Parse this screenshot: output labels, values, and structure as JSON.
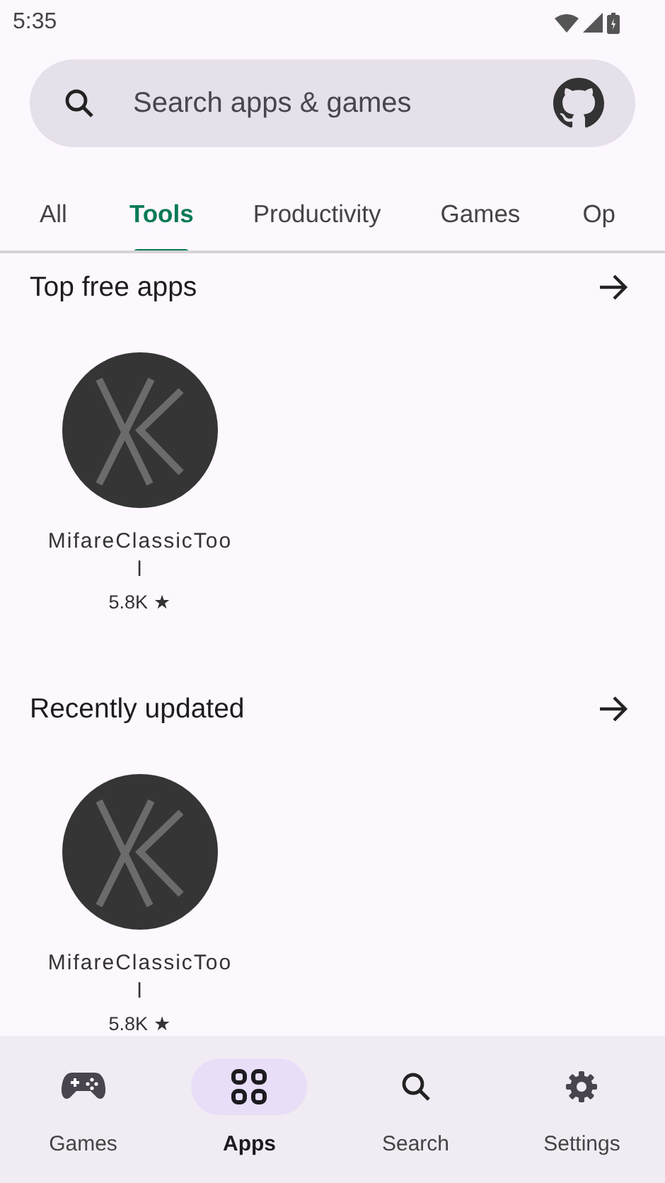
{
  "status_bar": {
    "time": "5:35"
  },
  "search": {
    "placeholder": "Search apps & games"
  },
  "tabs": [
    {
      "label": "All",
      "selected": false
    },
    {
      "label": "Tools",
      "selected": true
    },
    {
      "label": "Productivity",
      "selected": false
    },
    {
      "label": "Games",
      "selected": false
    },
    {
      "label": "Op",
      "selected": false
    }
  ],
  "sections": [
    {
      "title": "Top free apps",
      "apps": [
        {
          "name": "MifareClassicTool",
          "rating": "5.8K ★"
        }
      ]
    },
    {
      "title": "Recently updated",
      "apps": [
        {
          "name": "MifareClassicTool",
          "rating": "5.8K ★"
        }
      ]
    }
  ],
  "bottom_nav": [
    {
      "label": "Games",
      "kind": "games",
      "selected": false
    },
    {
      "label": "Apps",
      "kind": "apps",
      "selected": true
    },
    {
      "label": "Search",
      "kind": "search",
      "selected": false
    },
    {
      "label": "Settings",
      "kind": "settings",
      "selected": false
    }
  ]
}
